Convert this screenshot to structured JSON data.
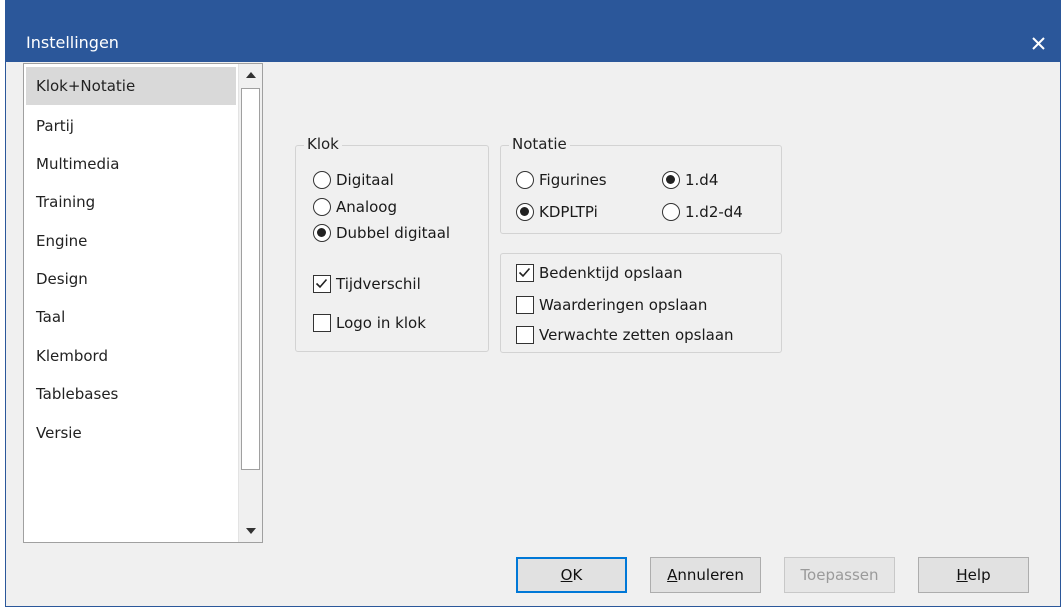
{
  "window": {
    "title": "Instellingen",
    "close_glyph": "✕"
  },
  "sidebar": {
    "items": [
      {
        "label": "Klok+Notatie",
        "selected": true
      },
      {
        "label": "Partij"
      },
      {
        "label": "Multimedia"
      },
      {
        "label": "Training"
      },
      {
        "label": "Engine"
      },
      {
        "label": "Design"
      },
      {
        "label": "Taal"
      },
      {
        "label": "Klembord"
      },
      {
        "label": "Tablebases"
      },
      {
        "label": "Versie"
      }
    ]
  },
  "klok": {
    "title": "Klok",
    "options": [
      {
        "label": "Digitaal",
        "checked": false
      },
      {
        "label": "Analoog",
        "checked": false
      },
      {
        "label": "Dubbel digitaal",
        "checked": true
      }
    ],
    "tijdverschil": {
      "label": "Tijdverschil",
      "checked": true
    },
    "logo": {
      "label": "Logo in klok",
      "checked": false
    }
  },
  "notatie": {
    "title": "Notatie",
    "figurines": {
      "label": "Figurines",
      "checked": false
    },
    "kdpltpi": {
      "label": "KDPLTPi",
      "checked": true
    },
    "d4": {
      "label": "1.d4",
      "checked": true
    },
    "d2d4": {
      "label": "1.d2-d4",
      "checked": false
    }
  },
  "opslaan": {
    "bedenktijd": {
      "label": "Bedenktijd opslaan",
      "checked": true
    },
    "waarderingen": {
      "label": "Waarderingen opslaan",
      "checked": false
    },
    "verwachte": {
      "label": "Verwachte zetten opslaan",
      "checked": false
    }
  },
  "buttons": {
    "ok": {
      "mnemonic": "O",
      "rest": "K"
    },
    "annuleren": {
      "mnemonic": "A",
      "rest": "nnuleren"
    },
    "toepassen": {
      "label": "Toepassen"
    },
    "help": {
      "mnemonic": "H",
      "rest": "elp"
    }
  },
  "colors": {
    "titlebar": "#2b579a",
    "dialog_bg": "#f0f0f0",
    "default_button_border": "#0078d7"
  }
}
